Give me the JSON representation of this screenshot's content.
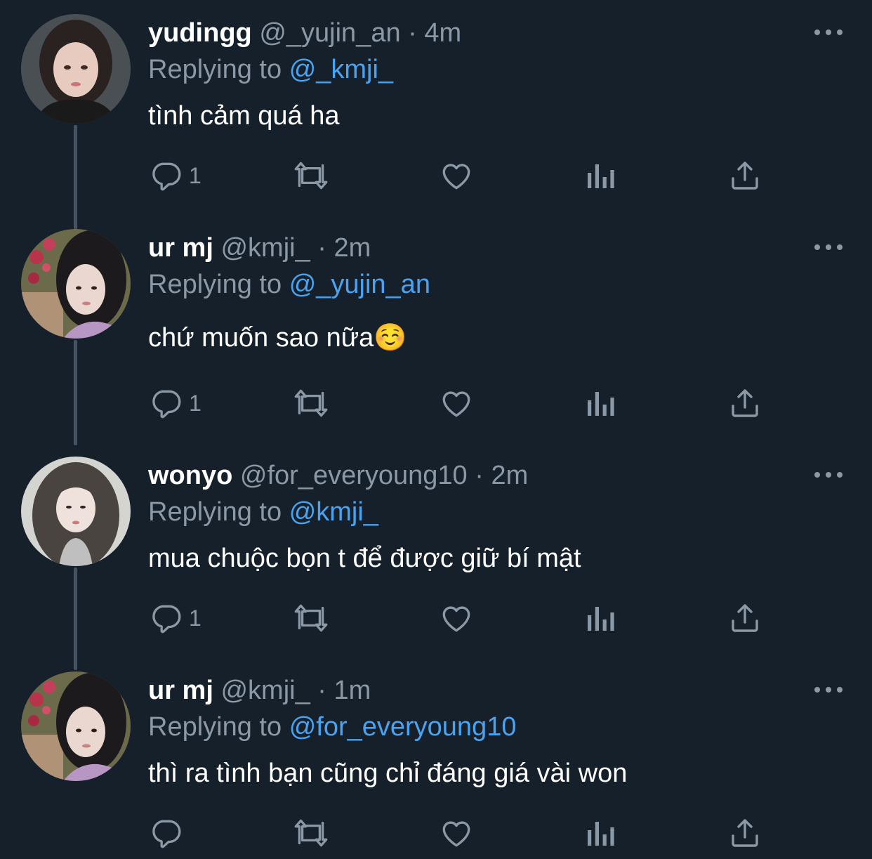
{
  "theme": {
    "background": "#15202b",
    "text_primary": "#ffffff",
    "text_secondary": "#8b98a5",
    "mention": "#4aa3f0",
    "thread_line": "#425364",
    "icon": "#8b98a5"
  },
  "tweets": [
    {
      "display_name": "yudingg",
      "handle": "@_yujin_an",
      "separator": "·",
      "time": "4m",
      "replying_label": "Replying to",
      "replying_to": "@_kmji_",
      "text": "tình cảm quá ha",
      "reply_count": "1",
      "icons": [
        "reply-icon",
        "retweet-icon",
        "like-icon",
        "views-icon",
        "share-icon",
        "more-icon"
      ]
    },
    {
      "display_name": "ur mj",
      "handle": "@kmji_",
      "separator": "·",
      "time": "2m",
      "replying_label": "Replying to",
      "replying_to": "@_yujin_an",
      "text": "chứ muốn sao nữa☺️",
      "reply_count": "1",
      "icons": [
        "reply-icon",
        "retweet-icon",
        "like-icon",
        "views-icon",
        "share-icon",
        "more-icon"
      ]
    },
    {
      "display_name": "wonyo",
      "handle": "@for_everyoung10",
      "separator": "·",
      "time": "2m",
      "replying_label": "Replying to",
      "replying_to": "@kmji_",
      "text": "mua chuộc bọn t để được giữ bí mật",
      "reply_count": "1",
      "icons": [
        "reply-icon",
        "retweet-icon",
        "like-icon",
        "views-icon",
        "share-icon",
        "more-icon"
      ]
    },
    {
      "display_name": "ur mj",
      "handle": "@kmji_",
      "separator": "·",
      "time": "1m",
      "replying_label": "Replying to",
      "replying_to": "@for_everyoung10",
      "text": "thì ra tình bạn cũng chỉ đáng giá vài won",
      "reply_count": "",
      "icons": [
        "reply-icon",
        "retweet-icon",
        "like-icon",
        "views-icon",
        "share-icon",
        "more-icon"
      ]
    }
  ]
}
